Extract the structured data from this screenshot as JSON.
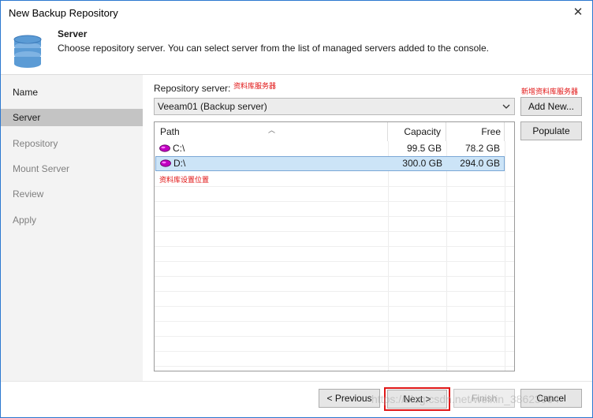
{
  "window": {
    "title": "New Backup Repository"
  },
  "header": {
    "title": "Server",
    "description": "Choose repository server. You can select server from the list of managed servers added to the console."
  },
  "sidebar": {
    "items": [
      {
        "label": "Name",
        "state": "done"
      },
      {
        "label": "Server",
        "state": "active"
      },
      {
        "label": "Repository",
        "state": "pending"
      },
      {
        "label": "Mount Server",
        "state": "pending"
      },
      {
        "label": "Review",
        "state": "pending"
      },
      {
        "label": "Apply",
        "state": "pending"
      }
    ]
  },
  "repository_server": {
    "label": "Repository server:",
    "annotation": "资料库服务器",
    "selected": "Veeam01 (Backup server)"
  },
  "buttons": {
    "add_new": "Add New...",
    "add_new_annotation": "新增资料库服务器",
    "populate": "Populate",
    "previous": "< Previous",
    "next": "Next >",
    "finish": "Finish",
    "cancel": "Cancel"
  },
  "table": {
    "columns": [
      "Path",
      "Capacity",
      "Free"
    ],
    "rows": [
      {
        "path": "C:\\",
        "capacity": "99.5 GB",
        "free": "78.2 GB",
        "selected": false
      },
      {
        "path": "D:\\",
        "capacity": "300.0 GB",
        "free": "294.0 GB",
        "selected": true
      }
    ],
    "annotation": "资料库设置位置"
  },
  "watermark": "https://blog.csdn.net/weixin_38623994",
  "colors": {
    "selection": "#cce4f7",
    "active_nav": "#c4c4c4",
    "annotation": "#e01010",
    "disk_icon": "#c000c0",
    "db_icon": "#5b9bd5"
  }
}
